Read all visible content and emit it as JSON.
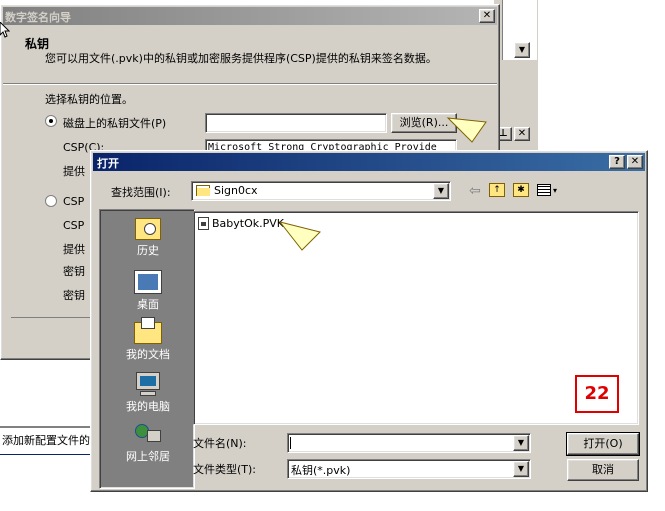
{
  "background_window": {
    "status_text": "添加新配置文件的"
  },
  "wizard": {
    "title": "数字签名向导",
    "section_title": "私钥",
    "description": "您可以用文件(.pvk)中的私钥或加密服务提供程序(CSP)提供的私钥来签名数据。",
    "select_location": "选择私钥的位置。",
    "radio_disk_label": "磁盘上的私钥文件(P)",
    "browse_label": "浏览(R)...",
    "csp_label": "CSP(C):",
    "csp_value": "Microsoft Strong Cryptographic Provide",
    "provider_type_label": "提供",
    "radio_csp_label": "CSP",
    "csp2_label": "CSP",
    "provider_label2": "提供",
    "key_container_label": "密钥",
    "key_type_label": "密钥"
  },
  "open_dialog": {
    "title": "打开",
    "look_in_label": "查找范围(I):",
    "look_in_value": "Sign0cx",
    "places": [
      {
        "label": "历史",
        "icon": "history-icon"
      },
      {
        "label": "桌面",
        "icon": "desktop-icon"
      },
      {
        "label": "我的文档",
        "icon": "my-documents-icon"
      },
      {
        "label": "我的电脑",
        "icon": "my-computer-icon"
      },
      {
        "label": "网上邻居",
        "icon": "network-places-icon"
      }
    ],
    "files": [
      "BabytOk.PVK"
    ],
    "filename_label": "文件名(N):",
    "filename_value": "",
    "filetype_label": "文件类型(T):",
    "filetype_value": "私钥(*.pvk)",
    "open_button": "打开(O)",
    "cancel_button": "取消"
  },
  "step_badge": "22",
  "colors": {
    "titlebar_active": "#0a246a",
    "titlebar_inactive": "#808080",
    "dialog_face": "#d4d0c8",
    "sidebar": "#808080",
    "badge_red": "#e00000",
    "callout_yellow": "#ffffc0"
  }
}
